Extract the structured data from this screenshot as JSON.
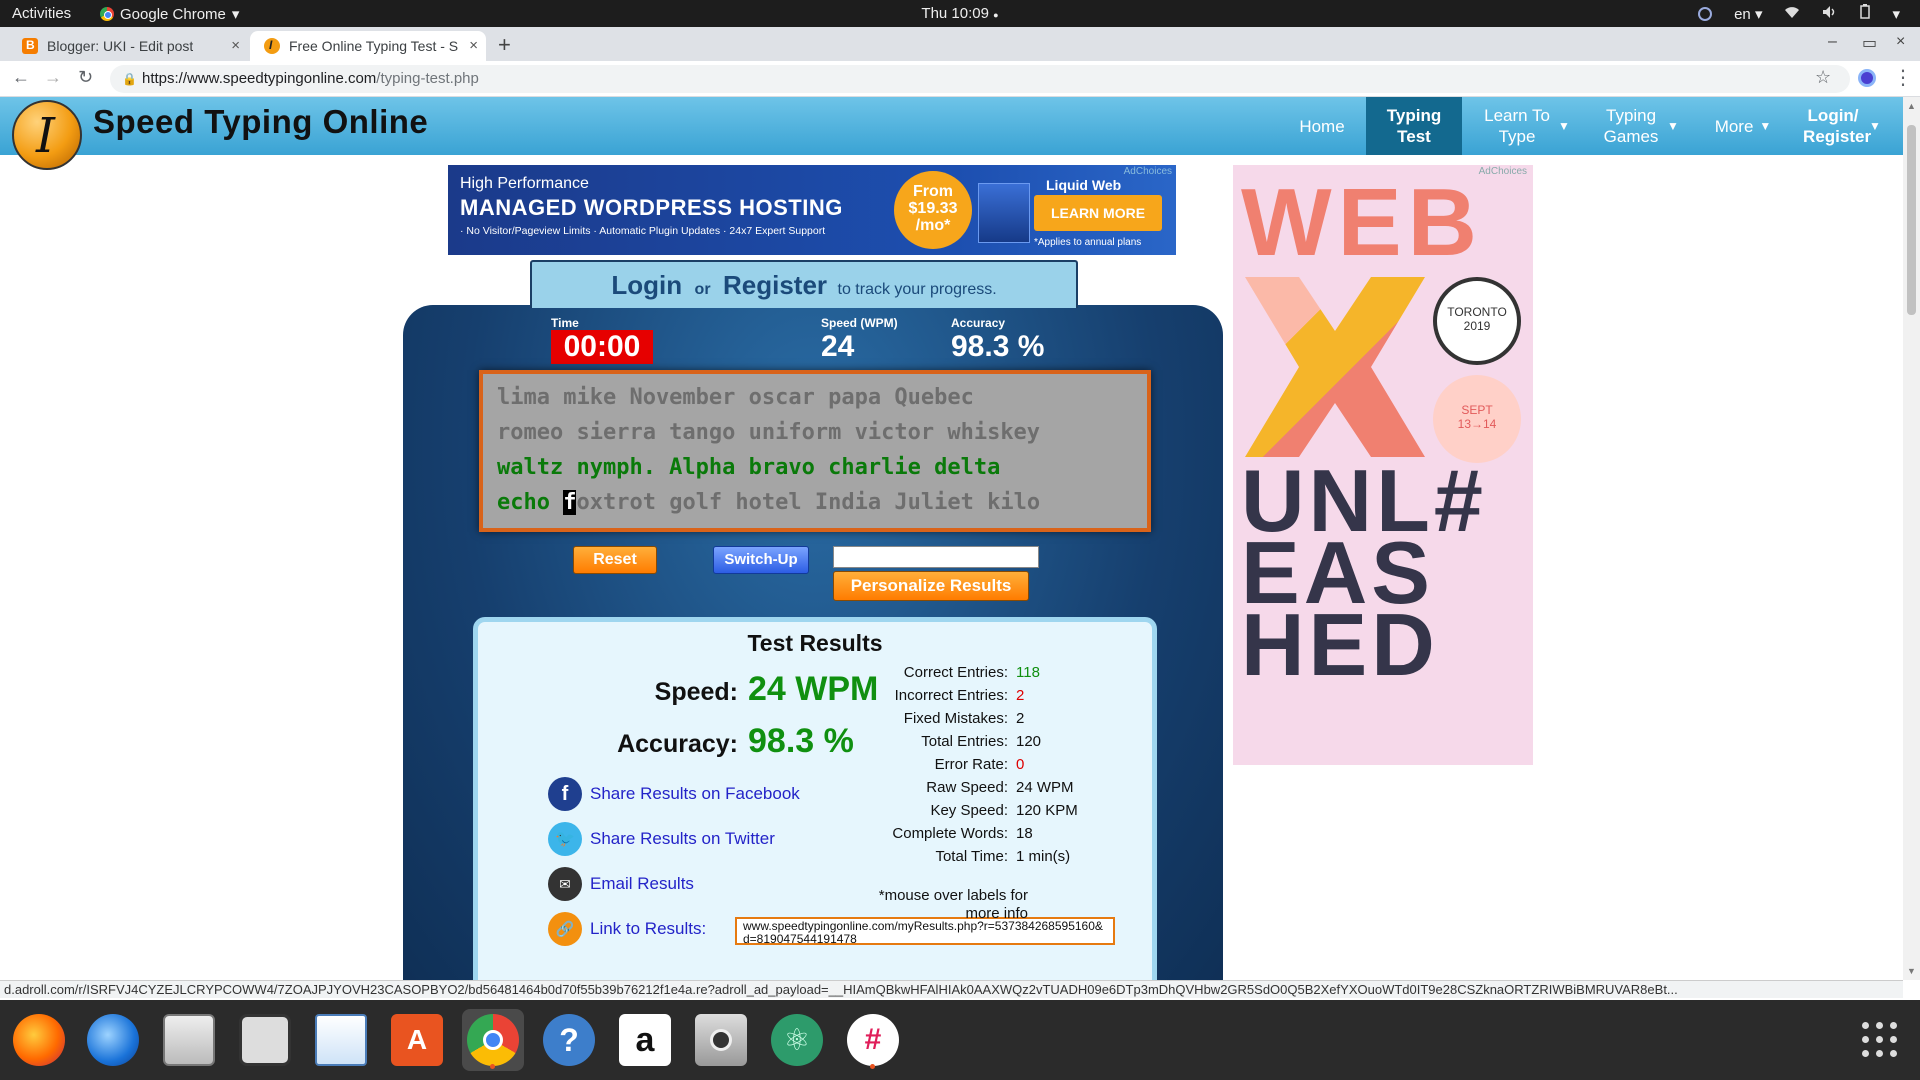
{
  "topbar": {
    "activities": "Activities",
    "app_name": "Google Chrome",
    "app_arrow": "▾",
    "clock": "Thu 10:09",
    "clock_dot": "●",
    "lang": "en",
    "lang_arrow": "▾",
    "wifi_icon": "wifi-icon",
    "sound_icon": "sound-icon",
    "battery_icon": "battery-icon",
    "power_arrow": "▾"
  },
  "tabs": [
    {
      "title": "Blogger: UKI - Edit post",
      "close": "×"
    },
    {
      "title": "Free Online Typing Test - S",
      "close": "×"
    }
  ],
  "new_tab": "+",
  "window_controls": {
    "min": "–",
    "max": "▭",
    "close": "×"
  },
  "toolbar": {
    "back": "←",
    "forward": "→",
    "reload": "↻",
    "url_host": "https://www.speedtypingonline.com",
    "url_path": "/typing-test.php",
    "star": "☆",
    "menu": "⋮"
  },
  "site": {
    "logo_letter": "I",
    "name": "Speed Typing Online",
    "nav": [
      {
        "label": "Home"
      },
      {
        "label": "Typing Test"
      },
      {
        "label": "Learn To Type"
      },
      {
        "label": "Typing Games"
      },
      {
        "label": "More"
      },
      {
        "label": "Login/ Register"
      }
    ],
    "nav_arrow": "▼"
  },
  "ad_banner": {
    "line1": "High Performance",
    "line2": "MANAGED WORDPRESS HOSTING",
    "line3": "· No Visitor/Pageview Limits · Automatic Plugin Updates · 24x7 Expert Support",
    "price_top": "From",
    "price": "$19.33",
    "price_unit": "/mo*",
    "brand": "Liquid Web",
    "cta": "LEARN MORE",
    "fine": "*Applies to annual plans",
    "adchoices": "AdChoices"
  },
  "login_bar": {
    "login": "Login",
    "or": "or",
    "register": "Register",
    "suffix": "to track your progress."
  },
  "stats": {
    "time_label": "Time",
    "time_value": "00:00",
    "speed_label": "Speed (WPM)",
    "speed_value": "24",
    "accuracy_label": "Accuracy",
    "accuracy_value": "98.3 %"
  },
  "typing_text": {
    "line1": "lima mike November oscar papa Quebec",
    "line2": "romeo sierra tango uniform victor whiskey",
    "line3_done": "waltz nymph. Alpha bravo charlie delta",
    "line4_done": "echo ",
    "line4_cursor": "f",
    "line4_rest": "oxtrot golf hotel India Juliet kilo"
  },
  "controls": {
    "reset": "Reset",
    "switch_up": "Switch-Up",
    "name_value": "",
    "personalize": "Personalize Results"
  },
  "results": {
    "title": "Test Results",
    "speed_label": "Speed:",
    "speed_value": "24 WPM",
    "accuracy_label": "Accuracy:",
    "accuracy_value": "98.3 %",
    "share_facebook": "Share Results on Facebook",
    "share_twitter": "Share Results on Twitter",
    "email": "Email Results",
    "link": "Link to Results:",
    "link_url": "www.speedtypingonline.com/myResults.php?r=537384268595160&d=819047544191478",
    "rows": [
      {
        "k": "Correct Entries:",
        "v": "118"
      },
      {
        "k": "Incorrect Entries:",
        "v": "2"
      },
      {
        "k": "Fixed Mistakes:",
        "v": "2"
      },
      {
        "k": "Total Entries:",
        "v": "120"
      },
      {
        "k": "Error Rate:",
        "v": "0"
      },
      {
        "k": "Raw Speed:",
        "v": "24 WPM"
      },
      {
        "k": "Key Speed:",
        "v": "120 KPM"
      },
      {
        "k": "Complete Words:",
        "v": "18"
      },
      {
        "k": "Total Time:",
        "v": "1 min(s)"
      }
    ],
    "mouse_note": "*mouse over labels for more info"
  },
  "side_ad": {
    "adchoices": "AdChoices",
    "web": "WEB",
    "city": "TORONTO",
    "year": "2019",
    "month": "SEPT",
    "dates": "13→14",
    "unl": "UNL#",
    "eas": "EAS",
    "hed": "HED"
  },
  "status_url": "d.adroll.com/r/ISRFVJ4CYZEJLCRYPCOWW4/7ZOAJPJYOVH23CASOPBYO2/bd56481464b0d70f55b39b76212f1e4a.re?adroll_ad_payload=__HIAmQBkwHFAlHIAk0AAXWQz2vTUADH09e6DTp3mDhQVHbw2GR5SdO0Q5B2XefYXOuoWTd0IT9e28CSZknaORTZRIWBiBMRUVAR8eBt...",
  "dock": [
    "firefox-icon",
    "thunderbird-icon",
    "files-icon",
    "rhythmbox-icon",
    "writer-icon",
    "software-center-icon",
    "chrome-icon",
    "help-icon",
    "amazon-icon",
    "screenshot-icon",
    "atom-icon",
    "slack-icon"
  ],
  "colors": {
    "header_blue": "#3aa3d4",
    "nav_active": "#13698f",
    "panel_blue": "#163f6e",
    "timer_red": "#e60000",
    "correct_green": "#109010",
    "error_red": "#dd0000",
    "orange_button": "#ff7c00"
  }
}
